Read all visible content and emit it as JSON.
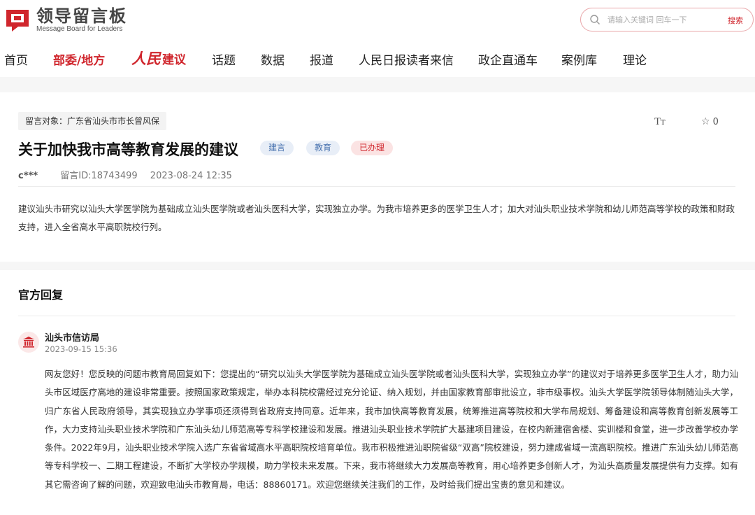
{
  "header": {
    "logo_cn": "领导留言板",
    "logo_en": "Message Board for Leaders",
    "search_placeholder": "请输入关键词 回车一下",
    "search_button": "搜索"
  },
  "nav": {
    "items": [
      "首页",
      "部委/地方",
      "话题",
      "数据",
      "报道",
      "人民日报读者来信",
      "政企直通车",
      "案例库",
      "理论"
    ],
    "rmjy_script": "人民",
    "rmjy_text": "建议"
  },
  "message": {
    "target": "留言对象：广东省汕头市市长曾风保",
    "font_toggle": "Tт",
    "favorites": "0",
    "title": "关于加快我市高等教育发展的建议",
    "tags": [
      "建言",
      "教育",
      "已办理"
    ],
    "author": "c***",
    "msg_id": "留言ID:18743499",
    "time": "2023-08-24 12:35",
    "content": "建议汕头市研究以汕头大学医学院为基础成立汕头医学院或者汕头医科大学，实现独立办学。为我市培养更多的医学卫生人才；加大对汕头职业技术学院和幼儿师范高等学校的政策和财政支持，进入全省高水平高职院校行列。"
  },
  "reply": {
    "heading": "官方回复",
    "department": "汕头市信访局",
    "time": "2023-09-15 15:36",
    "body": "网友您好！您反映的问题市教育局回复如下：您提出的“研究以汕头大学医学院为基础成立汕头医学院或者汕头医科大学，实现独立办学”的建议对于培养更多医学卫生人才，助力汕头市区域医疗高地的建设非常重要。按照国家政策规定，举办本科院校需经过充分论证、纳入规划，并由国家教育部审批设立，非市级事权。汕头大学医学院领导体制随汕头大学，归广东省人民政府领导，其实现独立办学事项还须得到省政府支持同意。近年来，我市加快高等教育发展，统筹推进高等院校和大学布局规划、筹备建设和高等教育创新发展等工作，大力支持汕头职业技术学院和广东汕头幼儿师范高等专科学校建设和发展。推进汕头职业技术学院扩大基建项目建设，在校内新建宿舍楼、实训楼和食堂，进一步改善学校办学条件。2022年9月，汕头职业技术学院入选广东省省域高水平高职院校培育单位。我市积极推进汕职院省级“双高”院校建设，努力建成省域一流高职院校。推进广东汕头幼儿师范高等专科学校一、二期工程建设，不断扩大学校办学规模，助力学校未来发展。下来，我市将继续大力发展高等教育，用心培养更多创新人才，为汕头高质量发展提供有力支撑。如有其它需咨询了解的问题，欢迎致电汕头市教育局，电话：88860171。欢迎您继续关注我们的工作，及时给我们提出宝贵的意见和建议。"
  },
  "colors": {
    "brand_red": "#d0262d",
    "tag_blue_bg": "#e8eef7",
    "tag_red_bg": "#fbe3e3"
  }
}
